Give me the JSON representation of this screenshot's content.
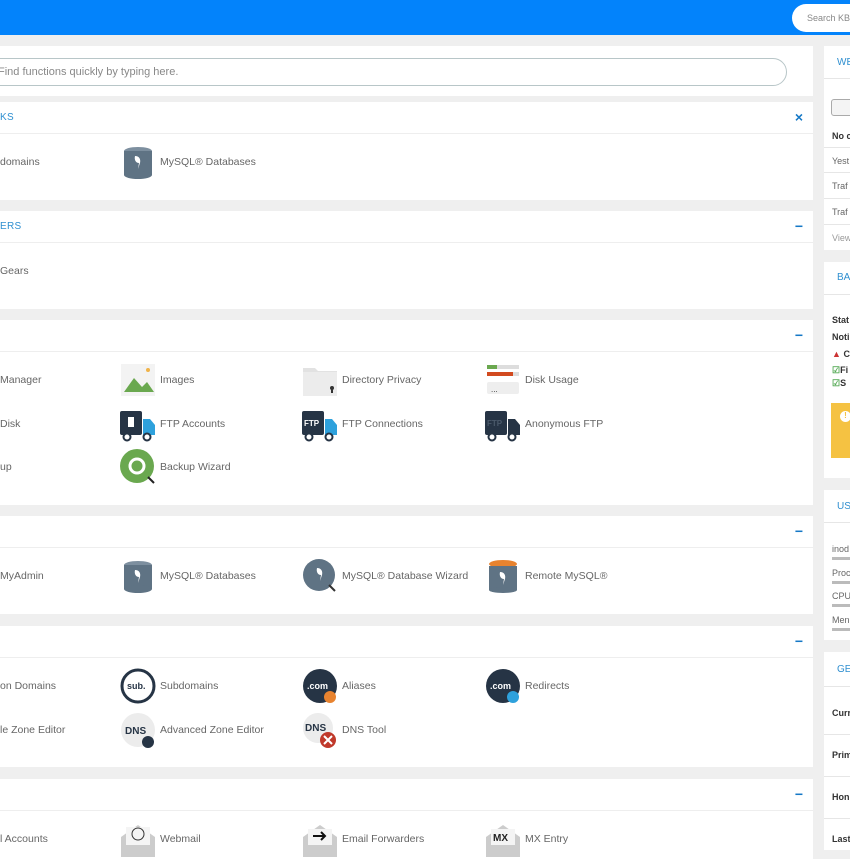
{
  "header": {
    "kb_search_placeholder": "Search KB"
  },
  "search": {
    "placeholder": "Find functions quickly by typing here."
  },
  "sections": [
    {
      "title": "KS",
      "control": "×",
      "items": [
        {
          "label": "domains",
          "icon": "none"
        },
        {
          "label": "MySQL® Databases",
          "icon": "mysql-db"
        }
      ]
    },
    {
      "title": "ERS",
      "control": "−",
      "items": [
        {
          "label": "Gears",
          "icon": "none"
        }
      ]
    },
    {
      "title": "",
      "control": "−",
      "items": [
        {
          "label": "Manager",
          "icon": "none"
        },
        {
          "label": "Images",
          "icon": "images"
        },
        {
          "label": "Directory Privacy",
          "icon": "folder-lock"
        },
        {
          "label": "Disk Usage",
          "icon": "disk-usage"
        },
        {
          "label": "Disk",
          "icon": "none"
        },
        {
          "label": "FTP Accounts",
          "icon": "ftp-accounts"
        },
        {
          "label": "FTP Connections",
          "icon": "ftp-connections"
        },
        {
          "label": "Anonymous FTP",
          "icon": "anonymous-ftp"
        },
        {
          "label": "up",
          "icon": "none"
        },
        {
          "label": "Backup Wizard",
          "icon": "backup-wizard"
        }
      ]
    },
    {
      "title": "",
      "control": "−",
      "items": [
        {
          "label": "MyAdmin",
          "icon": "none"
        },
        {
          "label": "MySQL® Databases",
          "icon": "mysql-db"
        },
        {
          "label": "MySQL® Database Wizard",
          "icon": "mysql-wizard"
        },
        {
          "label": "Remote MySQL®",
          "icon": "remote-mysql"
        }
      ]
    },
    {
      "title": "",
      "control": "−",
      "items": [
        {
          "label": "on Domains",
          "icon": "none"
        },
        {
          "label": "Subdomains",
          "icon": "subdomains"
        },
        {
          "label": "Aliases",
          "icon": "aliases"
        },
        {
          "label": "Redirects",
          "icon": "redirects"
        },
        {
          "label": "le Zone Editor",
          "icon": "none"
        },
        {
          "label": "Advanced Zone Editor",
          "icon": "dns-edit"
        },
        {
          "label": "DNS Tool",
          "icon": "dns-tool"
        }
      ]
    },
    {
      "title": "",
      "control": "−",
      "items": [
        {
          "label": "l Accounts",
          "icon": "none"
        },
        {
          "label": "Webmail",
          "icon": "webmail"
        },
        {
          "label": "Email Forwarders",
          "icon": "email-forwarders"
        },
        {
          "label": "MX Entry",
          "icon": "mx-entry"
        }
      ]
    }
  ],
  "sidebar": {
    "stats": {
      "title": "WE",
      "rows": [
        "No c",
        "Yest",
        "Traf",
        "Traf",
        "View"
      ]
    },
    "backup": {
      "title": "BA",
      "rows": [
        "Stat",
        "Noti",
        "C",
        "Fi",
        "S"
      ],
      "warning_color": "#f5c242"
    },
    "usage": {
      "title": "US",
      "rows": [
        "inod",
        "Proc",
        "CPU",
        "Men"
      ]
    },
    "general": {
      "title": "GE",
      "rows": [
        "Curr",
        "Prim",
        "Hon",
        "Last"
      ]
    }
  },
  "colors": {
    "topbar": "#0383fb",
    "accent": "#2f8fd0"
  }
}
